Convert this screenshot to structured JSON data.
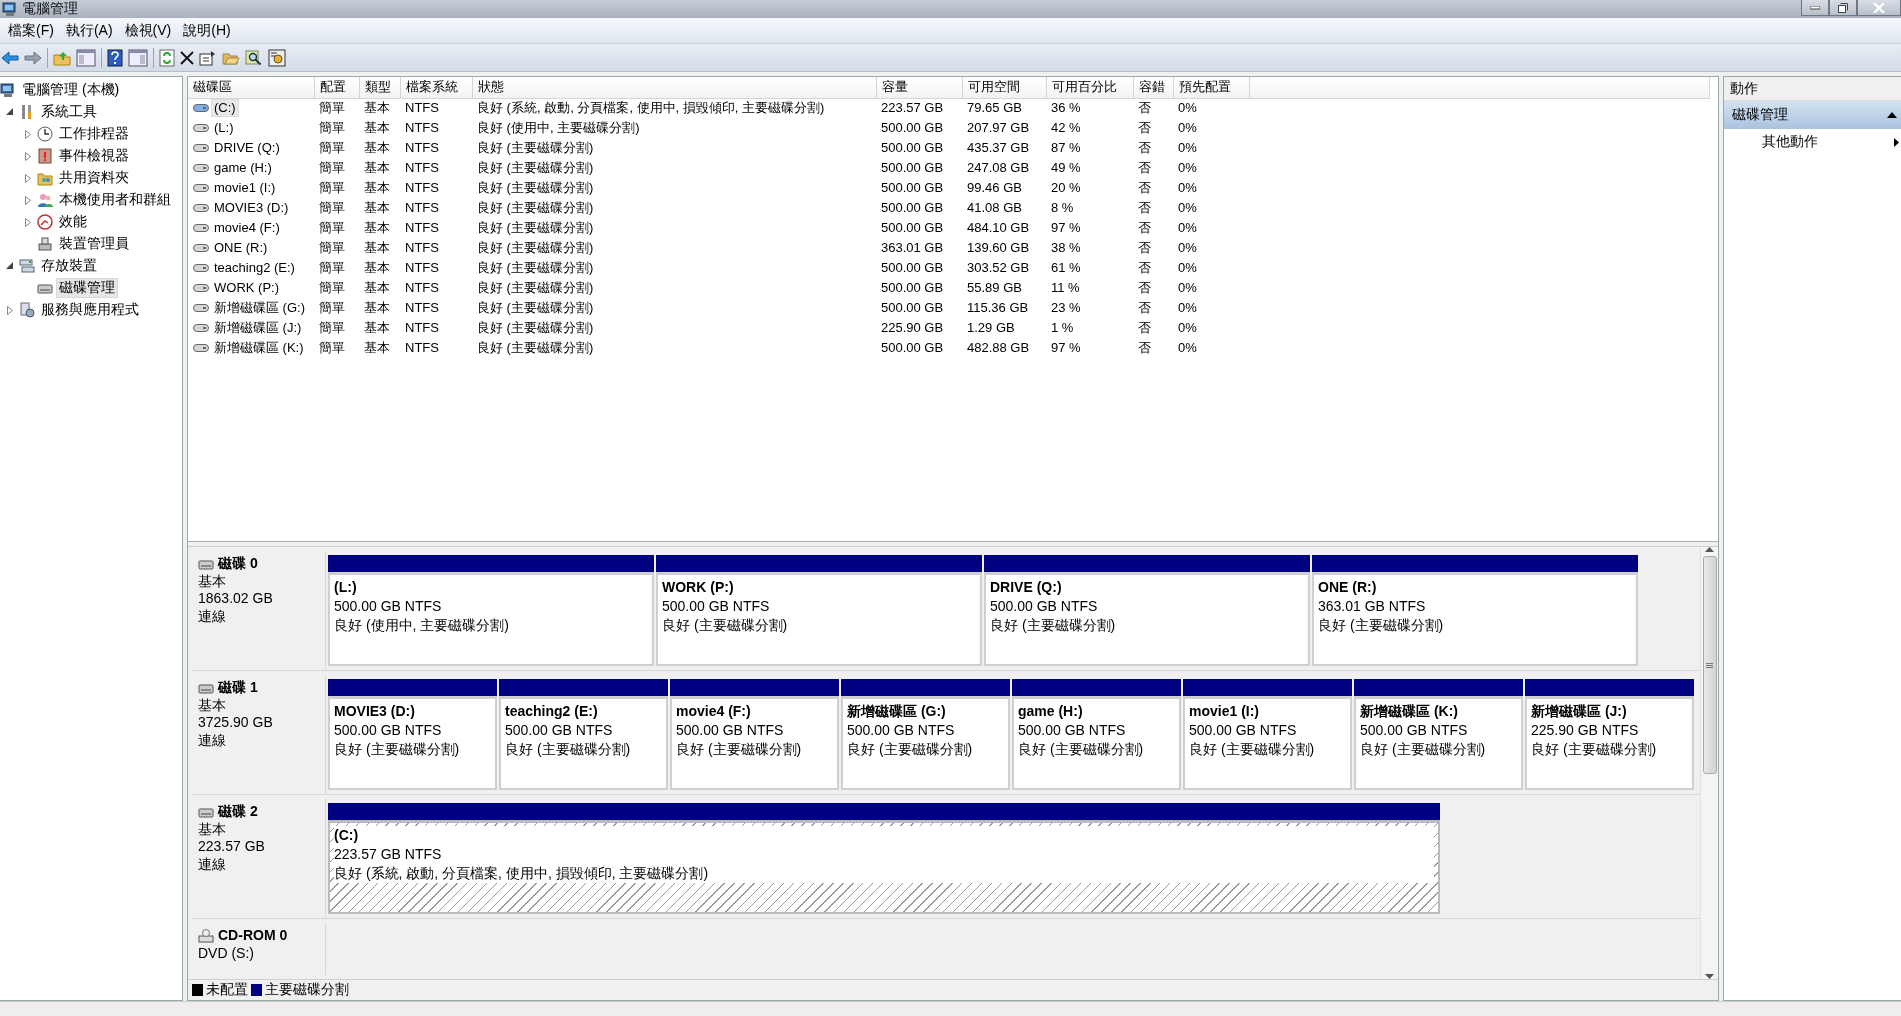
{
  "window": {
    "title": "電腦管理"
  },
  "menu": [
    "檔案(F)",
    "執行(A)",
    "檢視(V)",
    "說明(H)"
  ],
  "tree": {
    "label": "電腦管理 (本機)",
    "selected": false,
    "children": [
      {
        "label": "系統工具",
        "selected": false,
        "expanded": true,
        "children": [
          {
            "label": "工作排程器",
            "selected": false,
            "expanded": false
          },
          {
            "label": "事件檢視器",
            "selected": false,
            "expanded": false
          },
          {
            "label": "共用資料夾",
            "selected": false,
            "expanded": false
          },
          {
            "label": "本機使用者和群組",
            "selected": false,
            "expanded": false
          },
          {
            "label": "效能",
            "selected": false,
            "expanded": false
          },
          {
            "label": "裝置管理員",
            "selected": false
          }
        ]
      },
      {
        "label": "存放裝置",
        "selected": false,
        "expanded": true,
        "children": [
          {
            "label": "磁碟管理",
            "selected": true
          }
        ]
      },
      {
        "label": "服務與應用程式",
        "selected": false,
        "expanded": false
      }
    ]
  },
  "table": {
    "columns": [
      "磁碟區",
      "配置",
      "類型",
      "檔案系統",
      "狀態",
      "容量",
      "可用空間",
      "可用百分比",
      "容錯",
      "預先配置"
    ],
    "rows": [
      {
        "selected": true,
        "cells": [
          "(C:)",
          "簡單",
          "基本",
          "NTFS",
          "良好 (系統, 啟動, 分頁檔案, 使用中, 損毀傾印, 主要磁碟分割)",
          "223.57 GB",
          "79.65 GB",
          "36 %",
          "否",
          "0%"
        ]
      },
      {
        "selected": false,
        "cells": [
          "(L:)",
          "簡單",
          "基本",
          "NTFS",
          "良好 (使用中, 主要磁碟分割)",
          "500.00 GB",
          "207.97 GB",
          "42 %",
          "否",
          "0%"
        ]
      },
      {
        "selected": false,
        "cells": [
          "DRIVE (Q:)",
          "簡單",
          "基本",
          "NTFS",
          "良好 (主要磁碟分割)",
          "500.00 GB",
          "435.37 GB",
          "87 %",
          "否",
          "0%"
        ]
      },
      {
        "selected": false,
        "cells": [
          "game (H:)",
          "簡單",
          "基本",
          "NTFS",
          "良好 (主要磁碟分割)",
          "500.00 GB",
          "247.08 GB",
          "49 %",
          "否",
          "0%"
        ]
      },
      {
        "selected": false,
        "cells": [
          "movie1 (I:)",
          "簡單",
          "基本",
          "NTFS",
          "良好 (主要磁碟分割)",
          "500.00 GB",
          "99.46 GB",
          "20 %",
          "否",
          "0%"
        ]
      },
      {
        "selected": false,
        "cells": [
          "MOVIE3 (D:)",
          "簡單",
          "基本",
          "NTFS",
          "良好 (主要磁碟分割)",
          "500.00 GB",
          "41.08 GB",
          "8 %",
          "否",
          "0%"
        ]
      },
      {
        "selected": false,
        "cells": [
          "movie4 (F:)",
          "簡單",
          "基本",
          "NTFS",
          "良好 (主要磁碟分割)",
          "500.00 GB",
          "484.10 GB",
          "97 %",
          "否",
          "0%"
        ]
      },
      {
        "selected": false,
        "cells": [
          "ONE (R:)",
          "簡單",
          "基本",
          "NTFS",
          "良好 (主要磁碟分割)",
          "363.01 GB",
          "139.60 GB",
          "38 %",
          "否",
          "0%"
        ]
      },
      {
        "selected": false,
        "cells": [
          "teaching2 (E:)",
          "簡單",
          "基本",
          "NTFS",
          "良好 (主要磁碟分割)",
          "500.00 GB",
          "303.52 GB",
          "61 %",
          "否",
          "0%"
        ]
      },
      {
        "selected": false,
        "cells": [
          "WORK (P:)",
          "簡單",
          "基本",
          "NTFS",
          "良好 (主要磁碟分割)",
          "500.00 GB",
          "55.89 GB",
          "11 %",
          "否",
          "0%"
        ]
      },
      {
        "selected": false,
        "cells": [
          "新增磁碟區 (G:)",
          "簡單",
          "基本",
          "NTFS",
          "良好 (主要磁碟分割)",
          "500.00 GB",
          "115.36 GB",
          "23 %",
          "否",
          "0%"
        ]
      },
      {
        "selected": false,
        "cells": [
          "新增磁碟區 (J:)",
          "簡單",
          "基本",
          "NTFS",
          "良好 (主要磁碟分割)",
          "225.90 GB",
          "1.29 GB",
          "1 %",
          "否",
          "0%"
        ]
      },
      {
        "selected": false,
        "cells": [
          "新增磁碟區 (K:)",
          "簡單",
          "基本",
          "NTFS",
          "良好 (主要磁碟分割)",
          "500.00 GB",
          "482.88 GB",
          "97 %",
          "否",
          "0%"
        ]
      }
    ]
  },
  "disks": [
    {
      "kind": "disk",
      "name": "磁碟 0",
      "type": "基本",
      "size": "1863.02 GB",
      "status": "連線",
      "partitions": [
        {
          "name": "(L:)",
          "size": "500.00 GB NTFS",
          "status": "良好 (使用中, 主要磁碟分割)",
          "selected": false
        },
        {
          "name": "WORK (P:)",
          "size": "500.00 GB NTFS",
          "status": "良好 (主要磁碟分割)",
          "selected": false
        },
        {
          "name": "DRIVE (Q:)",
          "size": "500.00 GB NTFS",
          "status": "良好 (主要磁碟分割)",
          "selected": false
        },
        {
          "name": "ONE (R:)",
          "size": "363.01 GB NTFS",
          "status": "良好 (主要磁碟分割)",
          "selected": false
        }
      ]
    },
    {
      "kind": "disk",
      "name": "磁碟 1",
      "type": "基本",
      "size": "3725.90 GB",
      "status": "連線",
      "partitions": [
        {
          "name": "MOVIE3 (D:)",
          "size": "500.00 GB NTFS",
          "status": "良好 (主要磁碟分割)",
          "selected": false
        },
        {
          "name": "teaching2 (E:)",
          "size": "500.00 GB NTFS",
          "status": "良好 (主要磁碟分割)",
          "selected": false
        },
        {
          "name": "movie4 (F:)",
          "size": "500.00 GB NTFS",
          "status": "良好 (主要磁碟分割)",
          "selected": false
        },
        {
          "name": "新增磁碟區 (G:)",
          "size": "500.00 GB NTFS",
          "status": "良好 (主要磁碟分割)",
          "selected": false
        },
        {
          "name": "game (H:)",
          "size": "500.00 GB NTFS",
          "status": "良好 (主要磁碟分割)",
          "selected": false
        },
        {
          "name": "movie1 (I:)",
          "size": "500.00 GB NTFS",
          "status": "良好 (主要磁碟分割)",
          "selected": false
        },
        {
          "name": "新增磁碟區 (K:)",
          "size": "500.00 GB NTFS",
          "status": "良好 (主要磁碟分割)",
          "selected": false
        },
        {
          "name": "新增磁碟區 (J:)",
          "size": "225.90 GB NTFS",
          "status": "良好 (主要磁碟分割)",
          "selected": false
        }
      ]
    },
    {
      "kind": "disk",
      "name": "磁碟 2",
      "type": "基本",
      "size": "223.57 GB",
      "status": "連線",
      "partitions": [
        {
          "name": "(C:)",
          "size": "223.57 GB NTFS",
          "status": "良好 (系統, 啟動, 分頁檔案, 使用中, 損毀傾印, 主要磁碟分割)",
          "selected": true
        }
      ]
    },
    {
      "kind": "cdrom",
      "name": "CD-ROM 0",
      "type": "DVD (S:)"
    }
  ],
  "legend": [
    {
      "label": "未配置",
      "color": "#000000"
    },
    {
      "label": "主要磁碟分割",
      "color": "#000080"
    }
  ],
  "actions": {
    "title": "動作",
    "sections": [
      {
        "title": "磁碟管理",
        "expanded": true,
        "items": [
          "其他動作"
        ]
      }
    ]
  }
}
